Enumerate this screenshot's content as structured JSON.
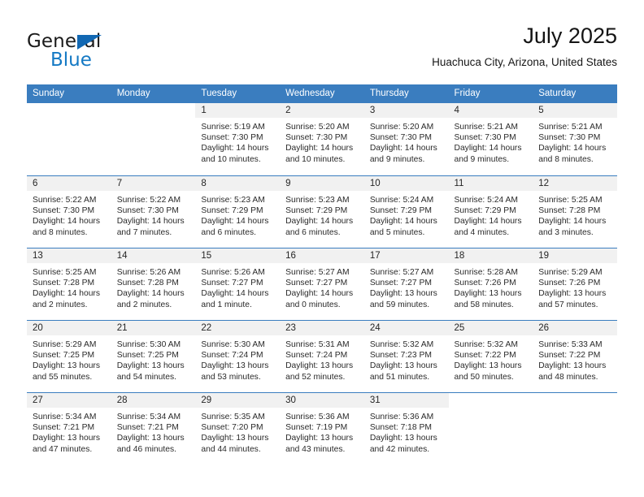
{
  "brand": {
    "name_dark": "General",
    "name_blue": "Blue",
    "accent_color": "#1479c4",
    "triangle_color": "#1268b3"
  },
  "header": {
    "title": "July 2025",
    "subtitle": "Huachuca City, Arizona, United States"
  },
  "theme": {
    "header_row_bg": "#3a7dbf",
    "daynum_band_bg": "#f1f1f1",
    "separator_color": "#3a7dbf"
  },
  "weekday_headers": [
    "Sunday",
    "Monday",
    "Tuesday",
    "Wednesday",
    "Thursday",
    "Friday",
    "Saturday"
  ],
  "weeks": [
    [
      {
        "day": "",
        "blank": true
      },
      {
        "day": "",
        "blank": true
      },
      {
        "day": "1",
        "sunrise": "Sunrise: 5:19 AM",
        "sunset": "Sunset: 7:30 PM",
        "daylight": "Daylight: 14 hours and 10 minutes."
      },
      {
        "day": "2",
        "sunrise": "Sunrise: 5:20 AM",
        "sunset": "Sunset: 7:30 PM",
        "daylight": "Daylight: 14 hours and 10 minutes."
      },
      {
        "day": "3",
        "sunrise": "Sunrise: 5:20 AM",
        "sunset": "Sunset: 7:30 PM",
        "daylight": "Daylight: 14 hours and 9 minutes."
      },
      {
        "day": "4",
        "sunrise": "Sunrise: 5:21 AM",
        "sunset": "Sunset: 7:30 PM",
        "daylight": "Daylight: 14 hours and 9 minutes."
      },
      {
        "day": "5",
        "sunrise": "Sunrise: 5:21 AM",
        "sunset": "Sunset: 7:30 PM",
        "daylight": "Daylight: 14 hours and 8 minutes."
      }
    ],
    [
      {
        "day": "6",
        "sunrise": "Sunrise: 5:22 AM",
        "sunset": "Sunset: 7:30 PM",
        "daylight": "Daylight: 14 hours and 8 minutes."
      },
      {
        "day": "7",
        "sunrise": "Sunrise: 5:22 AM",
        "sunset": "Sunset: 7:30 PM",
        "daylight": "Daylight: 14 hours and 7 minutes."
      },
      {
        "day": "8",
        "sunrise": "Sunrise: 5:23 AM",
        "sunset": "Sunset: 7:29 PM",
        "daylight": "Daylight: 14 hours and 6 minutes."
      },
      {
        "day": "9",
        "sunrise": "Sunrise: 5:23 AM",
        "sunset": "Sunset: 7:29 PM",
        "daylight": "Daylight: 14 hours and 6 minutes."
      },
      {
        "day": "10",
        "sunrise": "Sunrise: 5:24 AM",
        "sunset": "Sunset: 7:29 PM",
        "daylight": "Daylight: 14 hours and 5 minutes."
      },
      {
        "day": "11",
        "sunrise": "Sunrise: 5:24 AM",
        "sunset": "Sunset: 7:29 PM",
        "daylight": "Daylight: 14 hours and 4 minutes."
      },
      {
        "day": "12",
        "sunrise": "Sunrise: 5:25 AM",
        "sunset": "Sunset: 7:28 PM",
        "daylight": "Daylight: 14 hours and 3 minutes."
      }
    ],
    [
      {
        "day": "13",
        "sunrise": "Sunrise: 5:25 AM",
        "sunset": "Sunset: 7:28 PM",
        "daylight": "Daylight: 14 hours and 2 minutes."
      },
      {
        "day": "14",
        "sunrise": "Sunrise: 5:26 AM",
        "sunset": "Sunset: 7:28 PM",
        "daylight": "Daylight: 14 hours and 2 minutes."
      },
      {
        "day": "15",
        "sunrise": "Sunrise: 5:26 AM",
        "sunset": "Sunset: 7:27 PM",
        "daylight": "Daylight: 14 hours and 1 minute."
      },
      {
        "day": "16",
        "sunrise": "Sunrise: 5:27 AM",
        "sunset": "Sunset: 7:27 PM",
        "daylight": "Daylight: 14 hours and 0 minutes."
      },
      {
        "day": "17",
        "sunrise": "Sunrise: 5:27 AM",
        "sunset": "Sunset: 7:27 PM",
        "daylight": "Daylight: 13 hours and 59 minutes."
      },
      {
        "day": "18",
        "sunrise": "Sunrise: 5:28 AM",
        "sunset": "Sunset: 7:26 PM",
        "daylight": "Daylight: 13 hours and 58 minutes."
      },
      {
        "day": "19",
        "sunrise": "Sunrise: 5:29 AM",
        "sunset": "Sunset: 7:26 PM",
        "daylight": "Daylight: 13 hours and 57 minutes."
      }
    ],
    [
      {
        "day": "20",
        "sunrise": "Sunrise: 5:29 AM",
        "sunset": "Sunset: 7:25 PM",
        "daylight": "Daylight: 13 hours and 55 minutes."
      },
      {
        "day": "21",
        "sunrise": "Sunrise: 5:30 AM",
        "sunset": "Sunset: 7:25 PM",
        "daylight": "Daylight: 13 hours and 54 minutes."
      },
      {
        "day": "22",
        "sunrise": "Sunrise: 5:30 AM",
        "sunset": "Sunset: 7:24 PM",
        "daylight": "Daylight: 13 hours and 53 minutes."
      },
      {
        "day": "23",
        "sunrise": "Sunrise: 5:31 AM",
        "sunset": "Sunset: 7:24 PM",
        "daylight": "Daylight: 13 hours and 52 minutes."
      },
      {
        "day": "24",
        "sunrise": "Sunrise: 5:32 AM",
        "sunset": "Sunset: 7:23 PM",
        "daylight": "Daylight: 13 hours and 51 minutes."
      },
      {
        "day": "25",
        "sunrise": "Sunrise: 5:32 AM",
        "sunset": "Sunset: 7:22 PM",
        "daylight": "Daylight: 13 hours and 50 minutes."
      },
      {
        "day": "26",
        "sunrise": "Sunrise: 5:33 AM",
        "sunset": "Sunset: 7:22 PM",
        "daylight": "Daylight: 13 hours and 48 minutes."
      }
    ],
    [
      {
        "day": "27",
        "sunrise": "Sunrise: 5:34 AM",
        "sunset": "Sunset: 7:21 PM",
        "daylight": "Daylight: 13 hours and 47 minutes."
      },
      {
        "day": "28",
        "sunrise": "Sunrise: 5:34 AM",
        "sunset": "Sunset: 7:21 PM",
        "daylight": "Daylight: 13 hours and 46 minutes."
      },
      {
        "day": "29",
        "sunrise": "Sunrise: 5:35 AM",
        "sunset": "Sunset: 7:20 PM",
        "daylight": "Daylight: 13 hours and 44 minutes."
      },
      {
        "day": "30",
        "sunrise": "Sunrise: 5:36 AM",
        "sunset": "Sunset: 7:19 PM",
        "daylight": "Daylight: 13 hours and 43 minutes."
      },
      {
        "day": "31",
        "sunrise": "Sunrise: 5:36 AM",
        "sunset": "Sunset: 7:18 PM",
        "daylight": "Daylight: 13 hours and 42 minutes."
      },
      {
        "day": "",
        "blank": true
      },
      {
        "day": "",
        "blank": true
      }
    ]
  ]
}
